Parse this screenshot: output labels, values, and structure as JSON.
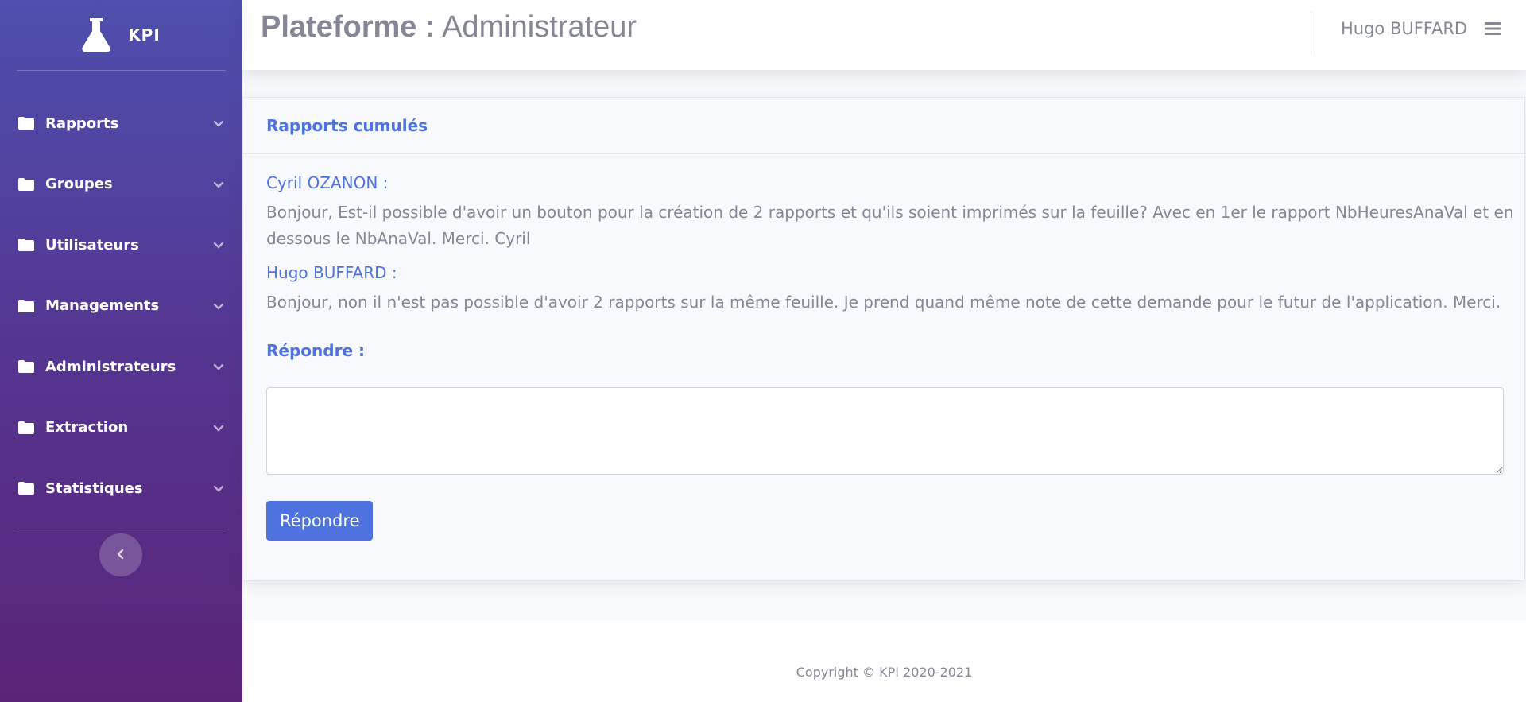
{
  "sidebar": {
    "brand": "KPI",
    "items": [
      {
        "label": "Rapports",
        "icon": "folder-icon"
      },
      {
        "label": "Groupes",
        "icon": "folder-icon"
      },
      {
        "label": "Utilisateurs",
        "icon": "folder-icon"
      },
      {
        "label": "Managements",
        "icon": "folder-icon"
      },
      {
        "label": "Administrateurs",
        "icon": "folder-icon"
      },
      {
        "label": "Extraction",
        "icon": "folder-icon"
      },
      {
        "label": "Statistiques",
        "icon": "folder-icon"
      }
    ],
    "toggle_icon": "chevron-left-icon"
  },
  "topbar": {
    "title_bold": "Plateforme :",
    "title_rest": " Administrateur",
    "user_name": "Hugo BUFFARD",
    "menu_icon": "hamburger-icon"
  },
  "card": {
    "title": "Rapports cumulés",
    "messages": [
      {
        "author": "Cyril OZANON :",
        "line1": "Bonjour, Est-il possible d'avoir un bouton pour la création de 2 rapports et qu'ils soient imprimés sur la feuille? Avec en 1er le rapport NbHeuresAnaVal et en",
        "line2": "dessous le NbAnaVal. Merci. Cyril"
      },
      {
        "author": "Hugo BUFFARD :",
        "line1": "Bonjour, non il n'est pas possible d'avoir 2 rapports sur la même feuille. Je prend quand même note de cette demande pour le futur de l'application. Merci."
      }
    ],
    "reply_label": "Répondre :",
    "reply_value": "",
    "reply_button": "Répondre"
  },
  "footer": {
    "copyright": "Copyright © KPI 2020-2021"
  },
  "colors": {
    "primary": "#4e73df",
    "sidebar_top": "#4e4fae",
    "sidebar_bottom": "#5a2579",
    "text_muted": "#858796"
  }
}
